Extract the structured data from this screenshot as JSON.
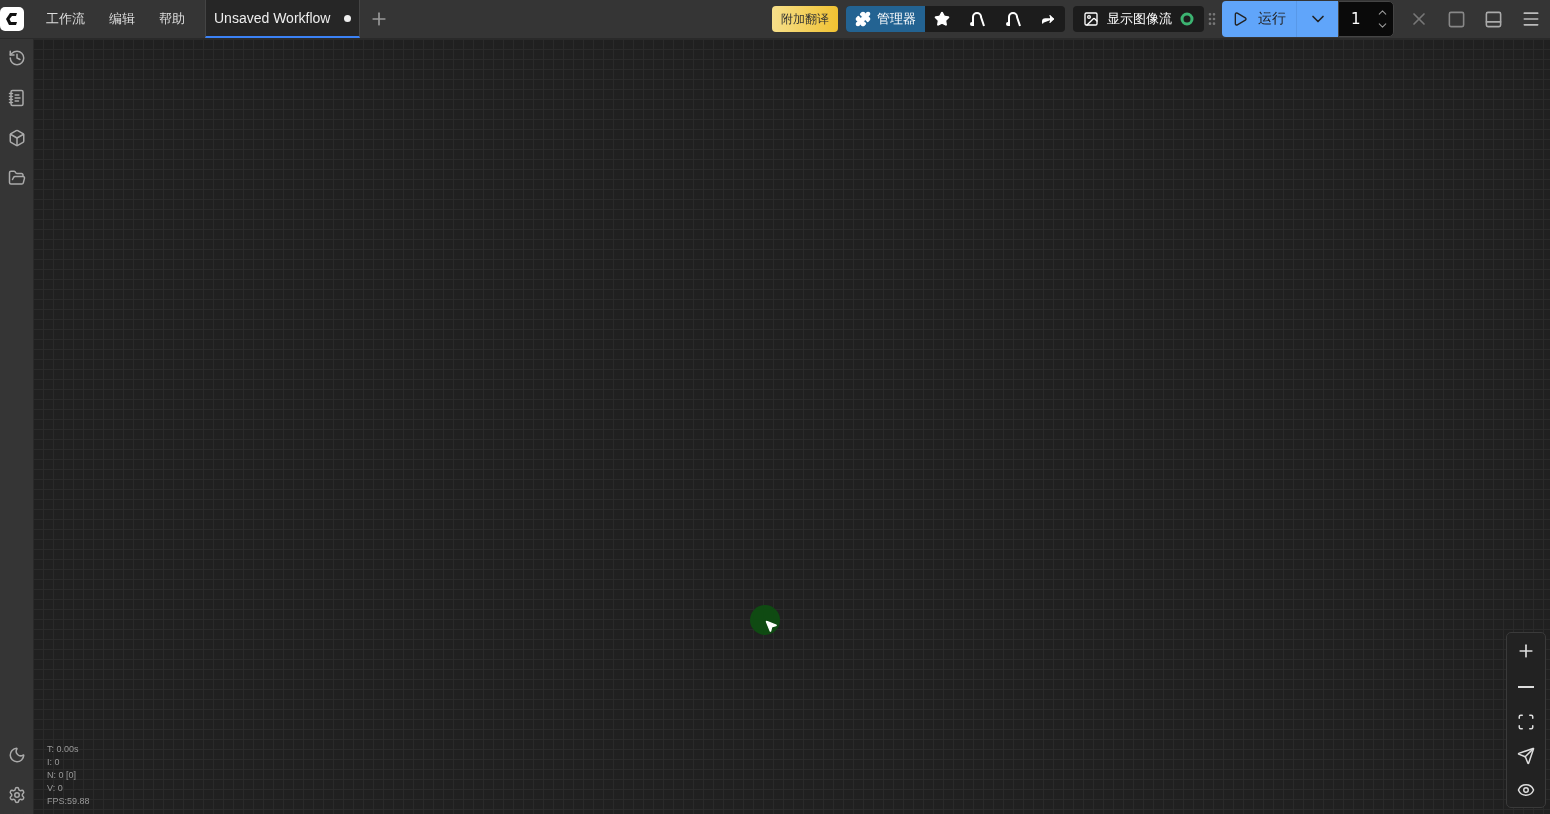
{
  "menu": [
    {
      "label": "工作流"
    },
    {
      "label": "编辑"
    },
    {
      "label": "帮助"
    }
  ],
  "tabs": [
    {
      "label": "Unsaved Workflow",
      "selected": true,
      "modified": true
    }
  ],
  "toolbar": {
    "translate_button": "附加翻译",
    "manager_button": "管理器",
    "image_feed_button": "显示图像流",
    "run_button": "运行",
    "batch_count": "1"
  },
  "stats": [
    "T: 0.00s",
    "I: 0",
    "N: 0 [0]",
    "V: 0",
    "FPS:59.88"
  ]
}
